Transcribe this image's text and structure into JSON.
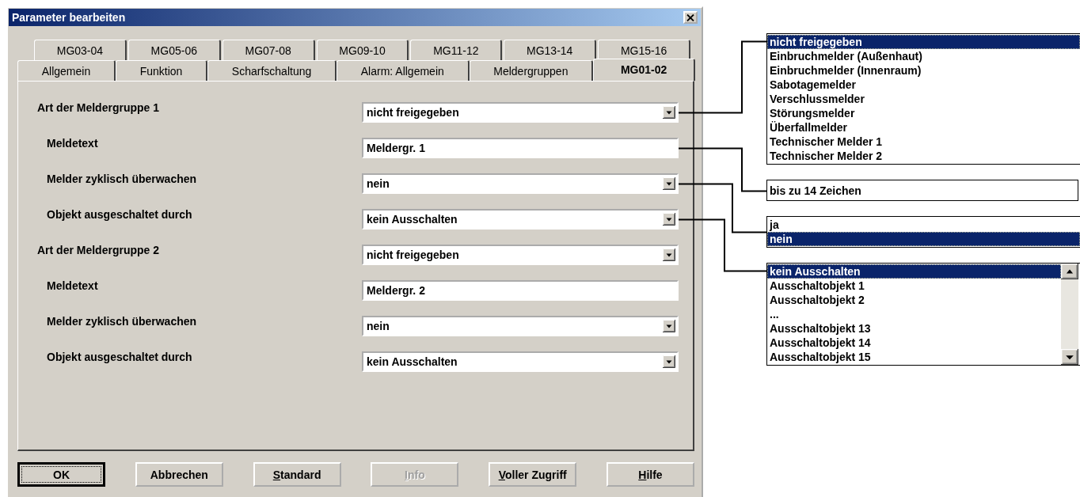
{
  "window": {
    "title": "Parameter bearbeiten"
  },
  "tabs_top": [
    {
      "label": "MG03-04",
      "selected": false
    },
    {
      "label": "MG05-06",
      "selected": false
    },
    {
      "label": "MG07-08",
      "selected": false
    },
    {
      "label": "MG09-10",
      "selected": false
    },
    {
      "label": "MG11-12",
      "selected": false
    },
    {
      "label": "MG13-14",
      "selected": false
    },
    {
      "label": "MG15-16",
      "selected": false
    }
  ],
  "tabs_bottom": [
    {
      "label": "Allgemein",
      "selected": false
    },
    {
      "label": "Funktion",
      "selected": false
    },
    {
      "label": "Scharfschaltung",
      "selected": false
    },
    {
      "label": "Alarm: Allgemein",
      "selected": false
    },
    {
      "label": "Meldergruppen",
      "selected": false
    },
    {
      "label": "MG01-02",
      "selected": true
    }
  ],
  "groups": [
    {
      "label": "Art der Meldergruppe 1",
      "value": "nicht freigegeben",
      "children": [
        {
          "kind": "text",
          "label": "Meldetext",
          "value": "Meldergr. 1"
        },
        {
          "kind": "dropdown",
          "label": "Melder zyklisch überwachen",
          "value": "nein"
        },
        {
          "kind": "dropdown",
          "label": "Objekt ausgeschaltet durch",
          "value": "kein Ausschalten"
        }
      ]
    },
    {
      "label": "Art der Meldergruppe 2",
      "value": "nicht freigegeben",
      "children": [
        {
          "kind": "text",
          "label": "Meldetext",
          "value": "Meldergr. 2"
        },
        {
          "kind": "dropdown",
          "label": "Melder zyklisch überwachen",
          "value": "nein"
        },
        {
          "kind": "dropdown",
          "label": "Objekt ausgeschaltet durch",
          "value": "kein Ausschalten"
        }
      ]
    }
  ],
  "buttons": [
    {
      "label": "OK",
      "default": true,
      "disabled": false
    },
    {
      "label": "Abbrechen",
      "default": false,
      "disabled": false
    },
    {
      "accel": "S",
      "label": "tandard",
      "default": false,
      "disabled": false
    },
    {
      "accel": "I",
      "label": "nfo",
      "default": false,
      "disabled": true
    },
    {
      "accel": "V",
      "label": "oller Zugriff",
      "default": false,
      "disabled": false
    },
    {
      "accel": "H",
      "label": "ilfe",
      "default": false,
      "disabled": false
    }
  ],
  "callouts": [
    {
      "kind": "list",
      "scrollbar": false,
      "items": [
        {
          "text": "nicht freigegeben",
          "selected": true
        },
        {
          "text": "Einbruchmelder (Außenhaut)",
          "selected": false
        },
        {
          "text": "Einbruchmelder (Innenraum)",
          "selected": false
        },
        {
          "text": "Sabotagemelder",
          "selected": false
        },
        {
          "text": "Verschlussmelder",
          "selected": false
        },
        {
          "text": "Störungsmelder",
          "selected": false
        },
        {
          "text": "Überfallmelder",
          "selected": false
        },
        {
          "text": "Technischer Melder 1",
          "selected": false
        },
        {
          "text": "Technischer Melder 2",
          "selected": false
        }
      ]
    },
    {
      "kind": "hint",
      "text": "bis zu 14 Zeichen"
    },
    {
      "kind": "list",
      "scrollbar": false,
      "items": [
        {
          "text": "ja",
          "selected": false
        },
        {
          "text": "nein",
          "selected": true
        }
      ]
    },
    {
      "kind": "list",
      "scrollbar": true,
      "items": [
        {
          "text": "kein Ausschalten",
          "selected": true
        },
        {
          "text": "Ausschaltobjekt 1",
          "selected": false
        },
        {
          "text": "Ausschaltobjekt 2",
          "selected": false
        },
        {
          "text": "...",
          "selected": false
        },
        {
          "text": "Ausschaltobjekt 13",
          "selected": false
        },
        {
          "text": "Ausschaltobjekt 14",
          "selected": false
        },
        {
          "text": "Ausschaltobjekt 15",
          "selected": false
        }
      ]
    }
  ]
}
